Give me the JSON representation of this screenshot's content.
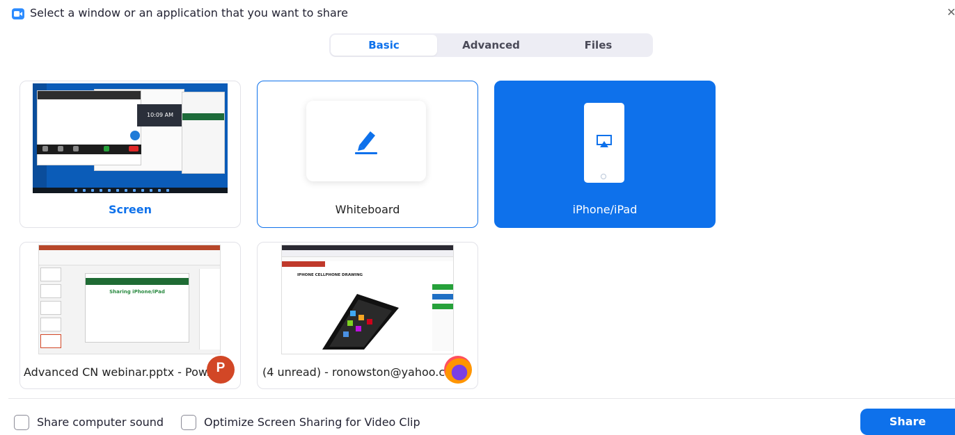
{
  "window": {
    "title": "Select a window or an application that you want to share",
    "close_glyph": "✕"
  },
  "tabs": [
    {
      "label": "Basic",
      "active": true
    },
    {
      "label": "Advanced",
      "active": false
    },
    {
      "label": "Files",
      "active": false
    }
  ],
  "cards": [
    {
      "label": "Screen",
      "type": "screen",
      "selected": false
    },
    {
      "label": "Whiteboard",
      "type": "whiteboard",
      "selected": false,
      "icon": "pen-icon"
    },
    {
      "label": "iPhone/iPad",
      "type": "device",
      "selected": true,
      "icon": "airplay-icon"
    },
    {
      "label": "Advanced CN webinar.pptx - Pow...",
      "type": "window",
      "app_icon": "powerpoint-icon",
      "app_letter": "P"
    },
    {
      "label": "(4 unread) - ronowston@yahoo.c...",
      "type": "window",
      "app_icon": "firefox-icon"
    }
  ],
  "thumbnails": {
    "screen_clock": "10:09 AM",
    "ppt_slide_title": "Sharing iPhone/iPad",
    "browser_heading": "IPHONE CELLPHONE DRAWING"
  },
  "footer": {
    "share_sound_label": "Share computer sound",
    "share_sound_checked": false,
    "optimize_label": "Optimize Screen Sharing for Video Clip",
    "optimize_checked": false,
    "share_button": "Share"
  },
  "colors": {
    "accent": "#0E71EB",
    "tab_bg": "#EDEDF4",
    "powerpoint": "#D24726"
  }
}
